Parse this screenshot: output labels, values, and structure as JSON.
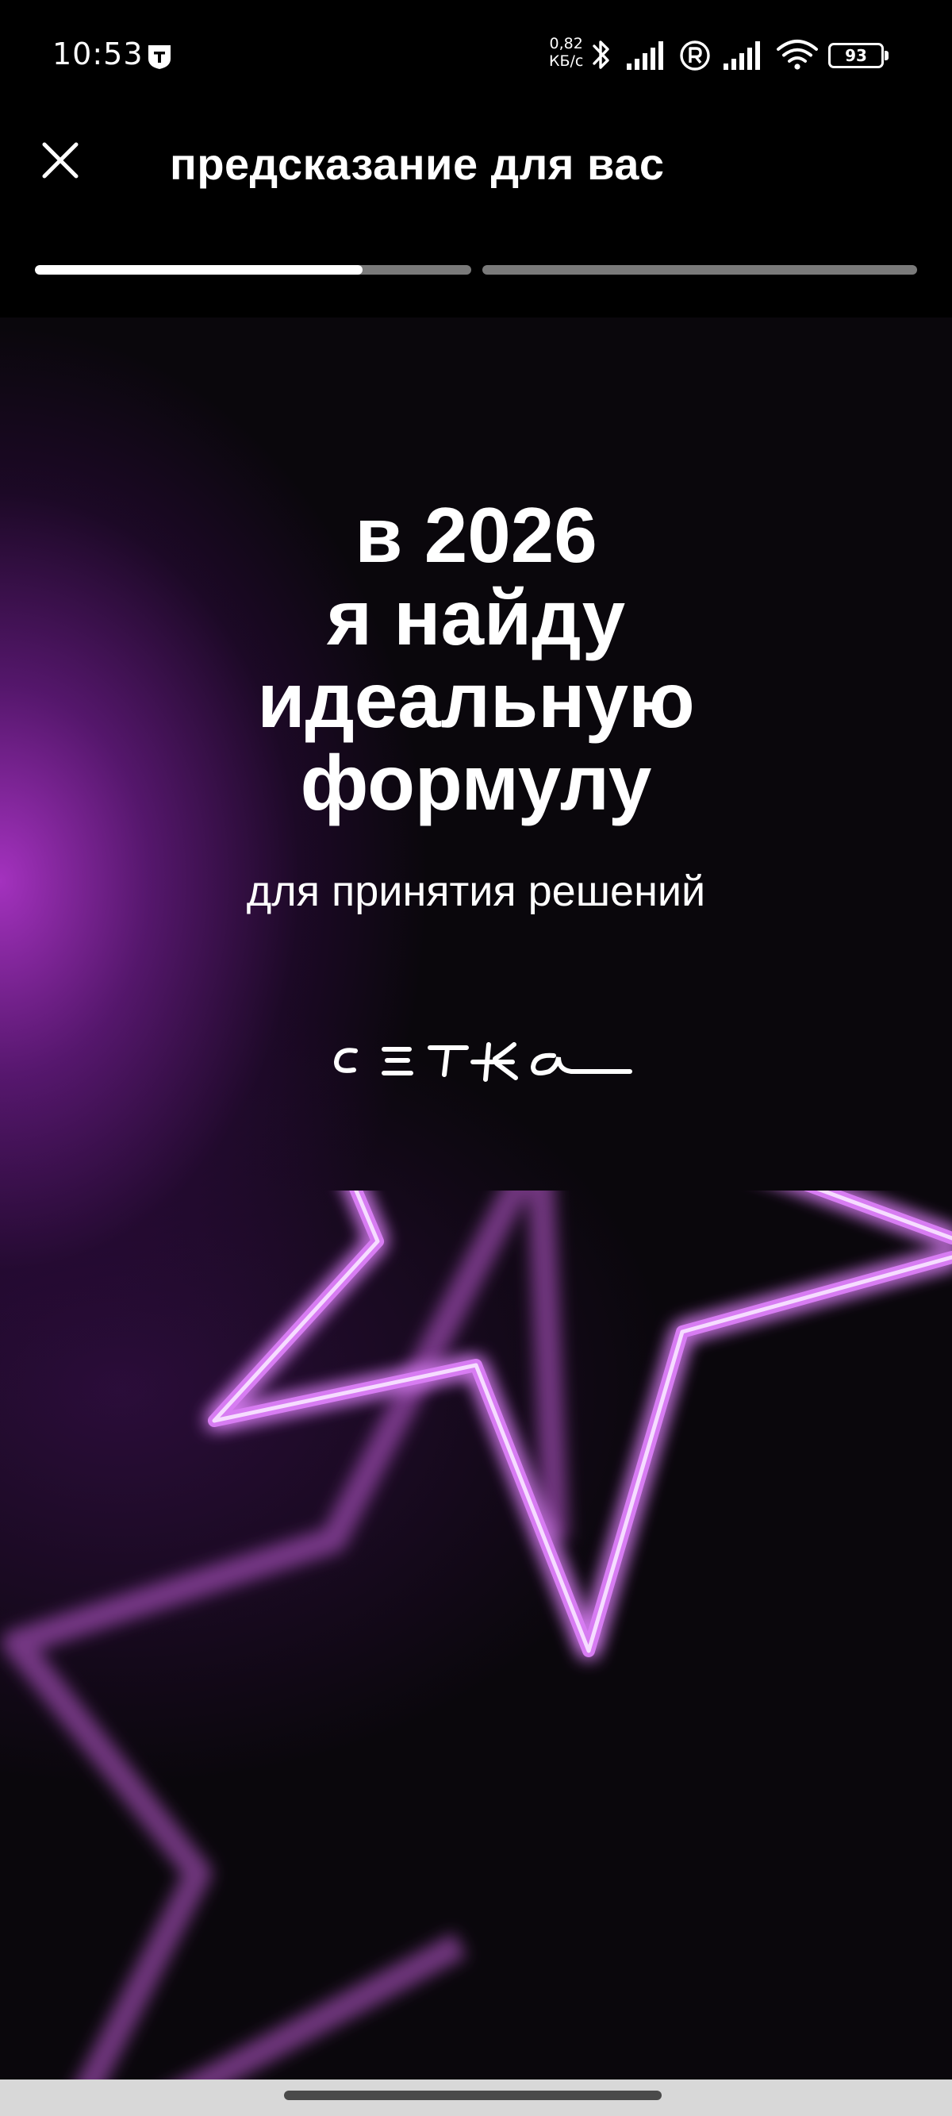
{
  "status_bar": {
    "time": "10:53",
    "net_speed_value": "0,82",
    "net_speed_unit": "КБ/с",
    "battery": "93",
    "icons": [
      "tinkoff-app-icon",
      "bluetooth-icon",
      "signal-icon",
      "roaming-icon",
      "signal-icon",
      "wifi-icon",
      "battery-icon"
    ]
  },
  "header": {
    "title": "предсказание для вас",
    "close_icon": "close-icon",
    "progress": [
      0.75,
      0.0
    ]
  },
  "story": {
    "title_lines": [
      "в 2026",
      "я найду",
      "идеальную",
      "формулу"
    ],
    "subtitle": "для принятия решений",
    "logo_text": "СЕТКА",
    "accent_color": "#c44be6",
    "background_color": "#0a070c"
  },
  "nav_bar": {
    "color": "#d8d8d8"
  }
}
